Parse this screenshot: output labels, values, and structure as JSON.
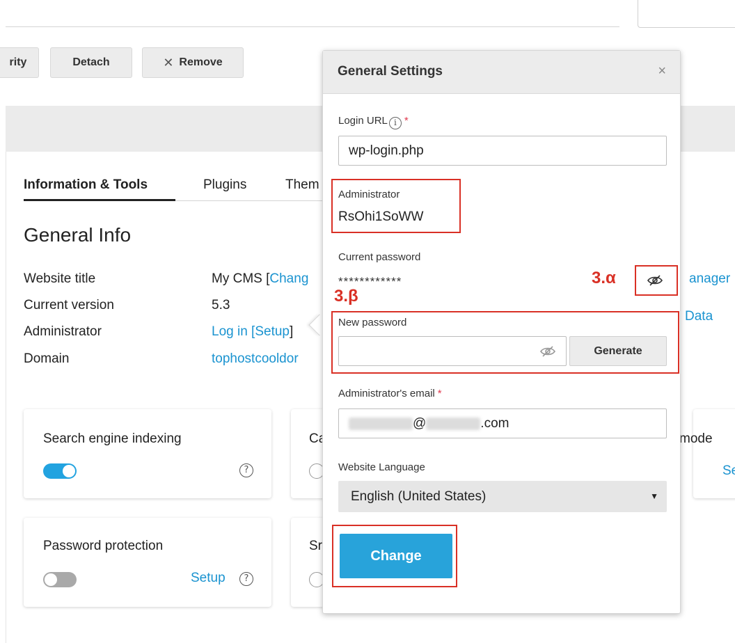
{
  "toolbar": {
    "security_label": "rity",
    "detach_label": "Detach",
    "remove_label": "Remove",
    "remove_icon": "close-x-icon"
  },
  "tabs": [
    {
      "label": "Information & Tools",
      "active": true
    },
    {
      "label": "Plugins",
      "active": false
    },
    {
      "label": "Them",
      "active": false
    }
  ],
  "general_info": {
    "heading": "General Info",
    "rows": [
      {
        "label": "Website title",
        "value_plain": "My CMS [",
        "value_link": "Chang"
      },
      {
        "label": "Current version",
        "value_plain": "5.3"
      },
      {
        "label": "Administrator",
        "login_link": "Log in",
        "bracket_open": " [",
        "setup_link": "Setup",
        "bracket_close": "]"
      },
      {
        "label": "Domain",
        "value_link": "tophostcooldor"
      }
    ]
  },
  "right_partial": {
    "manager": "anager",
    "data": "Data",
    "mode": "mode",
    "se": "Se"
  },
  "cards": {
    "search_indexing": {
      "title": "Search engine indexing",
      "toggle_on": true,
      "help": "?"
    },
    "card_ca": {
      "title": "Ca"
    },
    "password_protection": {
      "title": "Password protection",
      "toggle_on": false,
      "setup_label": "Setup",
      "help": "?"
    },
    "card_sr": {
      "title": "Sr"
    }
  },
  "modal": {
    "title": "General Settings",
    "close": "×",
    "login_url": {
      "label": "Login URL",
      "info": "i",
      "required": "*",
      "value": "wp-login.php"
    },
    "administrator": {
      "label": "Administrator",
      "value": "RsOhi1SoWW"
    },
    "current_password": {
      "label": "Current password",
      "value": "************"
    },
    "new_password": {
      "label": "New password",
      "value": "",
      "generate_label": "Generate"
    },
    "admin_email": {
      "label": "Administrator's email",
      "required": "*",
      "at": "@",
      "domain_suffix": ".com"
    },
    "language": {
      "label": "Website Language",
      "selected": "English (United States)",
      "arrow": "▼"
    },
    "change_label": "Change"
  },
  "annotations": {
    "alpha": "3.α",
    "beta": "3.β",
    "color": "#d93025"
  },
  "colors": {
    "accent": "#28a3da",
    "link": "#1a93d0"
  }
}
